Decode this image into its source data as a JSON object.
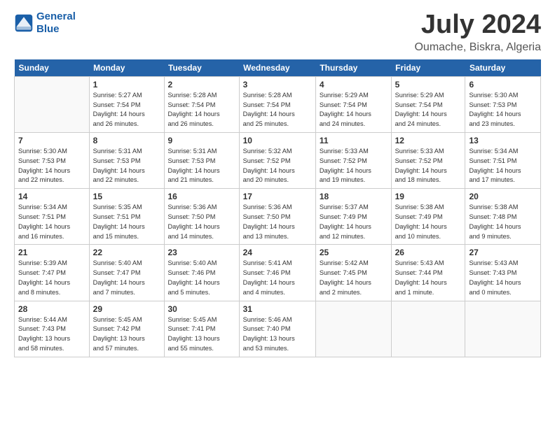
{
  "header": {
    "logo_line1": "General",
    "logo_line2": "Blue",
    "month": "July 2024",
    "location": "Oumache, Biskra, Algeria"
  },
  "days_of_week": [
    "Sunday",
    "Monday",
    "Tuesday",
    "Wednesday",
    "Thursday",
    "Friday",
    "Saturday"
  ],
  "weeks": [
    [
      {
        "day": "",
        "info": ""
      },
      {
        "day": "1",
        "info": "Sunrise: 5:27 AM\nSunset: 7:54 PM\nDaylight: 14 hours\nand 26 minutes."
      },
      {
        "day": "2",
        "info": "Sunrise: 5:28 AM\nSunset: 7:54 PM\nDaylight: 14 hours\nand 26 minutes."
      },
      {
        "day": "3",
        "info": "Sunrise: 5:28 AM\nSunset: 7:54 PM\nDaylight: 14 hours\nand 25 minutes."
      },
      {
        "day": "4",
        "info": "Sunrise: 5:29 AM\nSunset: 7:54 PM\nDaylight: 14 hours\nand 24 minutes."
      },
      {
        "day": "5",
        "info": "Sunrise: 5:29 AM\nSunset: 7:54 PM\nDaylight: 14 hours\nand 24 minutes."
      },
      {
        "day": "6",
        "info": "Sunrise: 5:30 AM\nSunset: 7:53 PM\nDaylight: 14 hours\nand 23 minutes."
      }
    ],
    [
      {
        "day": "7",
        "info": "Sunrise: 5:30 AM\nSunset: 7:53 PM\nDaylight: 14 hours\nand 22 minutes."
      },
      {
        "day": "8",
        "info": "Sunrise: 5:31 AM\nSunset: 7:53 PM\nDaylight: 14 hours\nand 22 minutes."
      },
      {
        "day": "9",
        "info": "Sunrise: 5:31 AM\nSunset: 7:53 PM\nDaylight: 14 hours\nand 21 minutes."
      },
      {
        "day": "10",
        "info": "Sunrise: 5:32 AM\nSunset: 7:52 PM\nDaylight: 14 hours\nand 20 minutes."
      },
      {
        "day": "11",
        "info": "Sunrise: 5:33 AM\nSunset: 7:52 PM\nDaylight: 14 hours\nand 19 minutes."
      },
      {
        "day": "12",
        "info": "Sunrise: 5:33 AM\nSunset: 7:52 PM\nDaylight: 14 hours\nand 18 minutes."
      },
      {
        "day": "13",
        "info": "Sunrise: 5:34 AM\nSunset: 7:51 PM\nDaylight: 14 hours\nand 17 minutes."
      }
    ],
    [
      {
        "day": "14",
        "info": "Sunrise: 5:34 AM\nSunset: 7:51 PM\nDaylight: 14 hours\nand 16 minutes."
      },
      {
        "day": "15",
        "info": "Sunrise: 5:35 AM\nSunset: 7:51 PM\nDaylight: 14 hours\nand 15 minutes."
      },
      {
        "day": "16",
        "info": "Sunrise: 5:36 AM\nSunset: 7:50 PM\nDaylight: 14 hours\nand 14 minutes."
      },
      {
        "day": "17",
        "info": "Sunrise: 5:36 AM\nSunset: 7:50 PM\nDaylight: 14 hours\nand 13 minutes."
      },
      {
        "day": "18",
        "info": "Sunrise: 5:37 AM\nSunset: 7:49 PM\nDaylight: 14 hours\nand 12 minutes."
      },
      {
        "day": "19",
        "info": "Sunrise: 5:38 AM\nSunset: 7:49 PM\nDaylight: 14 hours\nand 10 minutes."
      },
      {
        "day": "20",
        "info": "Sunrise: 5:38 AM\nSunset: 7:48 PM\nDaylight: 14 hours\nand 9 minutes."
      }
    ],
    [
      {
        "day": "21",
        "info": "Sunrise: 5:39 AM\nSunset: 7:47 PM\nDaylight: 14 hours\nand 8 minutes."
      },
      {
        "day": "22",
        "info": "Sunrise: 5:40 AM\nSunset: 7:47 PM\nDaylight: 14 hours\nand 7 minutes."
      },
      {
        "day": "23",
        "info": "Sunrise: 5:40 AM\nSunset: 7:46 PM\nDaylight: 14 hours\nand 5 minutes."
      },
      {
        "day": "24",
        "info": "Sunrise: 5:41 AM\nSunset: 7:46 PM\nDaylight: 14 hours\nand 4 minutes."
      },
      {
        "day": "25",
        "info": "Sunrise: 5:42 AM\nSunset: 7:45 PM\nDaylight: 14 hours\nand 2 minutes."
      },
      {
        "day": "26",
        "info": "Sunrise: 5:43 AM\nSunset: 7:44 PM\nDaylight: 14 hours\nand 1 minute."
      },
      {
        "day": "27",
        "info": "Sunrise: 5:43 AM\nSunset: 7:43 PM\nDaylight: 14 hours\nand 0 minutes."
      }
    ],
    [
      {
        "day": "28",
        "info": "Sunrise: 5:44 AM\nSunset: 7:43 PM\nDaylight: 13 hours\nand 58 minutes."
      },
      {
        "day": "29",
        "info": "Sunrise: 5:45 AM\nSunset: 7:42 PM\nDaylight: 13 hours\nand 57 minutes."
      },
      {
        "day": "30",
        "info": "Sunrise: 5:45 AM\nSunset: 7:41 PM\nDaylight: 13 hours\nand 55 minutes."
      },
      {
        "day": "31",
        "info": "Sunrise: 5:46 AM\nSunset: 7:40 PM\nDaylight: 13 hours\nand 53 minutes."
      },
      {
        "day": "",
        "info": ""
      },
      {
        "day": "",
        "info": ""
      },
      {
        "day": "",
        "info": ""
      }
    ]
  ]
}
